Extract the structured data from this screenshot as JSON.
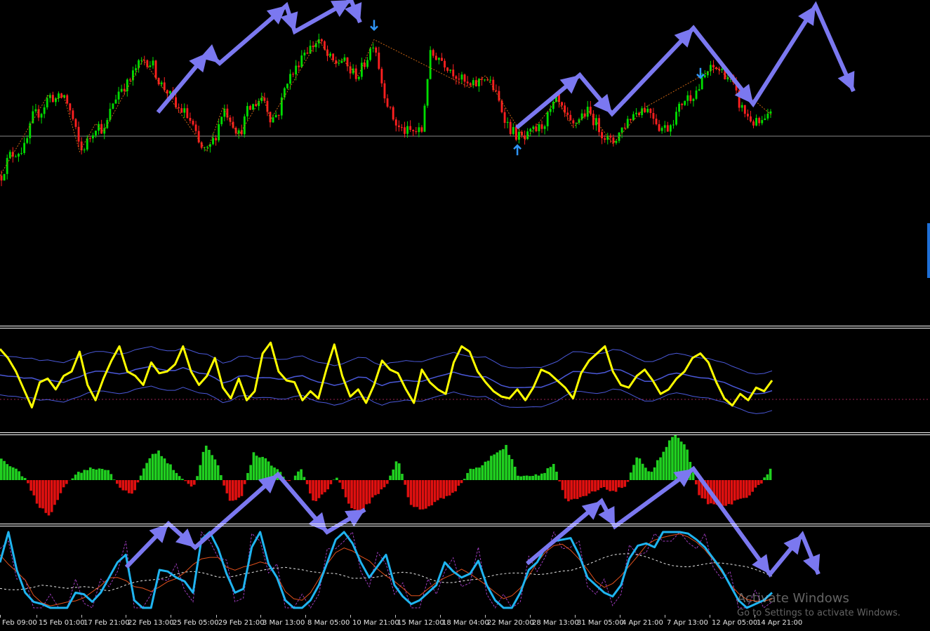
{
  "colors": {
    "background": "#000000",
    "bull_candle": "#00dd00",
    "bear_candle": "#ff2020",
    "zigzag": "#c86414",
    "arrow_annotation": "#7b78f0",
    "signal_arrow": "#2f95f5",
    "osc_main": "#ffff00",
    "osc_band": "#4a58d8",
    "hist_pos": "#20d020",
    "hist_neg": "#e01010",
    "stoch_main": "#1fb4f0",
    "stoch_signal": "#e0501c",
    "stoch_dots": "#9a3ab8",
    "stoch_avg": "#e8e8e8",
    "separator": "#ffffff",
    "level_line": "#c0c0c0",
    "zero_dotted": "#9a2250"
  },
  "time_axis": {
    "labels": [
      "Feb 09:00",
      "15 Feb 01:00",
      "17 Feb 21:00",
      "22 Feb 13:00",
      "25 Feb 05:00",
      "29 Feb 21:00",
      "3 Mar 13:00",
      "8 Mar 05:00",
      "10 Mar 21:00",
      "15 Mar 12:00",
      "18 Mar 04:00",
      "22 Mar 20:00",
      "28 Mar 13:00",
      "31 Mar 05:00",
      "4 Apr 21:00",
      "7 Apr 13:00",
      "12 Apr 05:00",
      "14 Apr 21:00"
    ]
  },
  "watermark": {
    "title": "Activate Windows",
    "subtitle": "Go to Settings to activate Windows."
  },
  "chart_data": [
    {
      "pane": "price",
      "type": "candlestick",
      "close_path": [
        28,
        38,
        40,
        42,
        58,
        60,
        68,
        66,
        68,
        56,
        40,
        46,
        54,
        50,
        64,
        72,
        74,
        82,
        86,
        84,
        74,
        70,
        62,
        60,
        54,
        42,
        40,
        48,
        62,
        56,
        48,
        60,
        64,
        68,
        56,
        60,
        76,
        80,
        90,
        92,
        96,
        88,
        84,
        86,
        80,
        78,
        86,
        96,
        74,
        60,
        52,
        50,
        50,
        50,
        88,
        88,
        84,
        80,
        76,
        72,
        74,
        78,
        72,
        62,
        52,
        48,
        46,
        50,
        52,
        58,
        66,
        58,
        52,
        58,
        60,
        54,
        48,
        44,
        50,
        56,
        60,
        62,
        60,
        52,
        52,
        58,
        66,
        68,
        72,
        80,
        82,
        80,
        76,
        64,
        58,
        54,
        54,
        58
      ],
      "signal_arrows": [
        {
          "type": "down",
          "index": 47
        },
        {
          "type": "up",
          "index": 65
        },
        {
          "type": "down",
          "index": 88
        }
      ]
    },
    {
      "pane": "oscillator",
      "type": "line",
      "series": [
        {
          "role": "main",
          "values": [
            85,
            75,
            60,
            40,
            20,
            48,
            52,
            40,
            55,
            60,
            82,
            45,
            28,
            52,
            72,
            88,
            60,
            55,
            45,
            70,
            58,
            60,
            68,
            88,
            60,
            45,
            55,
            75,
            42,
            30,
            52,
            28,
            38,
            80,
            92,
            60,
            50,
            48,
            28,
            38,
            30,
            62,
            90,
            55,
            32,
            40,
            25,
            45,
            72,
            62,
            58,
            40,
            25,
            62,
            48,
            40,
            35,
            70,
            88,
            82,
            60,
            48,
            38,
            32,
            30,
            40,
            28,
            42,
            62,
            58,
            50,
            42,
            30,
            58,
            72,
            80,
            88,
            60,
            45,
            42,
            55,
            62,
            50,
            35,
            40,
            52,
            60,
            75,
            80,
            70,
            48,
            30,
            22,
            35,
            28,
            42,
            38,
            50
          ]
        },
        {
          "role": "band_upper",
          "values": []
        },
        {
          "role": "band_lower",
          "values": []
        }
      ]
    },
    {
      "pane": "histogram",
      "type": "bar",
      "values": [
        40,
        22,
        5,
        -45,
        -65,
        -20,
        8,
        20,
        22,
        18,
        -20,
        -25,
        30,
        55,
        28,
        5,
        -15,
        65,
        28,
        -40,
        -28,
        48,
        40,
        18,
        -5,
        20,
        -42,
        -20,
        8,
        -50,
        -58,
        -30,
        -12,
        42,
        -45,
        -55,
        -42,
        -30,
        -15,
        20,
        25,
        48,
        62,
        10,
        8,
        12,
        30,
        -40,
        -35,
        -25,
        -15,
        -20,
        -10,
        45,
        12,
        48,
        85,
        60,
        -25,
        -45,
        -50,
        -40,
        -30,
        -12,
        20
      ]
    },
    {
      "pane": "stochastic",
      "type": "line",
      "series": [
        {
          "role": "main",
          "values": [
            60,
            100,
            50,
            20,
            8,
            5,
            0,
            0,
            0,
            20,
            18,
            8,
            20,
            40,
            60,
            70,
            10,
            0,
            0,
            50,
            48,
            40,
            35,
            20,
            90,
            100,
            78,
            45,
            20,
            25,
            80,
            100,
            58,
            40,
            10,
            0,
            0,
            10,
            30,
            60,
            90,
            100,
            85,
            60,
            40,
            55,
            70,
            30,
            15,
            5,
            10,
            20,
            30,
            60,
            48,
            40,
            45,
            62,
            30,
            10,
            0,
            0,
            20,
            50,
            60,
            80,
            88,
            90,
            92,
            70,
            40,
            30,
            20,
            15,
            30,
            65,
            82,
            85,
            80,
            100,
            100,
            100,
            98,
            90,
            80,
            65,
            50,
            30,
            10,
            0,
            5,
            10,
            20
          ]
        },
        {
          "role": "signal",
          "values": []
        },
        {
          "role": "dots",
          "values": []
        },
        {
          "role": "average",
          "values": []
        }
      ]
    }
  ]
}
